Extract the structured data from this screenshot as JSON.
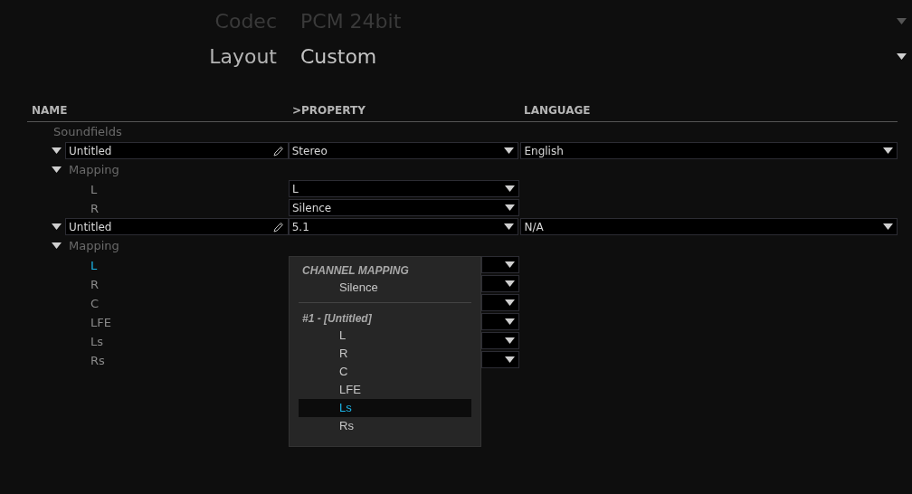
{
  "format": [
    {
      "label": "Codec",
      "value": "PCM 24bit",
      "disabled": true
    },
    {
      "label": "Layout",
      "value": "Custom",
      "disabled": false
    }
  ],
  "table": {
    "columns": [
      "NAME",
      ">PROPERTY",
      "LANGUAGE"
    ],
    "section": "Soundfields",
    "soundfields": [
      {
        "name": "Untitled",
        "property": "Stereo",
        "language": "English",
        "expanded": true,
        "mapping": {
          "label": "Mapping",
          "expanded": true,
          "channels": [
            {
              "name": "L",
              "value": "L",
              "selected": false
            },
            {
              "name": "R",
              "value": "Silence",
              "selected": false
            }
          ]
        }
      },
      {
        "name": "Untitled",
        "property": "5.1",
        "language": "N/A",
        "expanded": true,
        "mapping": {
          "label": "Mapping",
          "expanded": true,
          "channels": [
            {
              "name": "L",
              "selected": true
            },
            {
              "name": "R",
              "selected": false
            },
            {
              "name": "C",
              "selected": false
            },
            {
              "name": "LFE",
              "selected": false
            },
            {
              "name": "Ls",
              "selected": false
            },
            {
              "name": "Rs",
              "selected": false
            }
          ]
        }
      }
    ]
  },
  "popup": {
    "sections": [
      {
        "heading": "CHANNEL MAPPING",
        "items": [
          {
            "label": "Silence",
            "selected": false
          }
        ]
      },
      {
        "heading": "#1 - [Untitled]",
        "items": [
          {
            "label": "L",
            "selected": false
          },
          {
            "label": "R",
            "selected": false
          },
          {
            "label": "C",
            "selected": false
          },
          {
            "label": "LFE",
            "selected": false
          },
          {
            "label": "Ls",
            "selected": true
          },
          {
            "label": "Rs",
            "selected": false
          }
        ]
      }
    ]
  }
}
